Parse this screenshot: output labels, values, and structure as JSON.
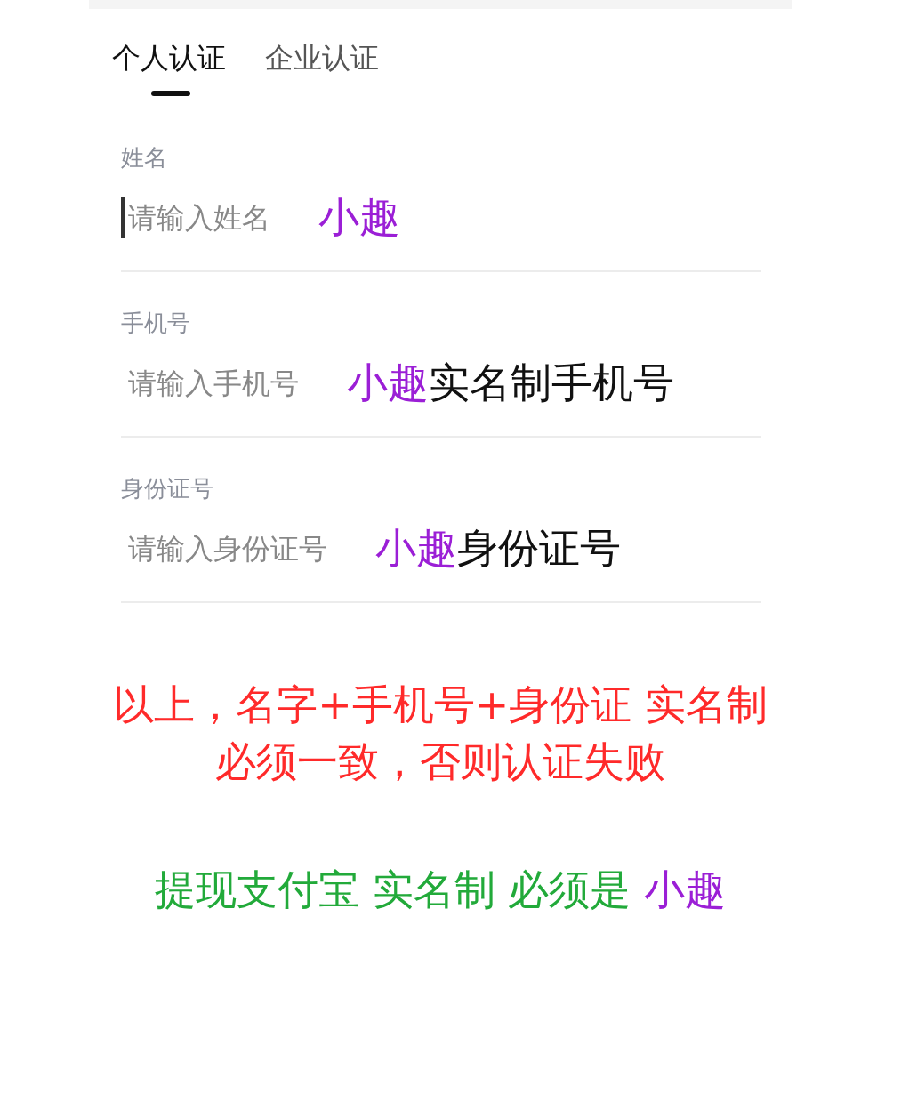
{
  "tabs": [
    {
      "label": "个人认证",
      "selected": true
    },
    {
      "label": "企业认证",
      "selected": false
    }
  ],
  "fields": [
    {
      "label": "姓名",
      "placeholder": "请输入姓名",
      "focused": true,
      "annotation": [
        {
          "text": "小趣",
          "color": "#9b1fd6"
        }
      ]
    },
    {
      "label": "手机号",
      "placeholder": "请输入手机号",
      "focused": false,
      "annotation": [
        {
          "text": "小趣",
          "color": "#9b1fd6"
        },
        {
          "text": "实名制手机号",
          "color": "#111111"
        }
      ]
    },
    {
      "label": "身份证号",
      "placeholder": "请输入身份证号",
      "focused": false,
      "annotation": [
        {
          "text": "小趣",
          "color": "#9b1fd6"
        },
        {
          "text": "身份证号",
          "color": "#111111"
        }
      ]
    }
  ],
  "notes": [
    {
      "lines": [
        "以上，名字+手机号+身份证 实名制",
        "必须一致，否则认证失败"
      ],
      "color": "#ff2a2a"
    },
    {
      "segments": [
        {
          "text": "提现支付宝 实名制 必须是 ",
          "color": "#22aa3a"
        },
        {
          "text": "小趣",
          "color": "#9b1fd6"
        }
      ]
    }
  ]
}
